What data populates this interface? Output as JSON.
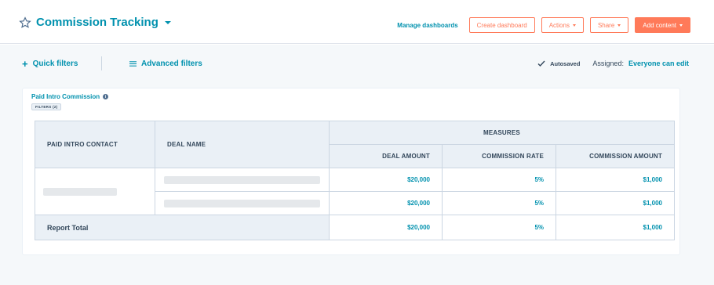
{
  "header": {
    "title": "Commission Tracking",
    "manage_dashboards": "Manage dashboards",
    "create_dashboard": "Create dashboard",
    "actions": "Actions",
    "share": "Share",
    "add_content": "Add content"
  },
  "filters": {
    "quick": "Quick filters",
    "advanced": "Advanced filters",
    "autosaved": "Autosaved",
    "assigned_label": "Assigned:",
    "assigned_value": "Everyone can edit"
  },
  "report": {
    "title": "Paid Intro Commission",
    "filters_badge": "FILTERS (2)",
    "columns": {
      "paid_intro_contact": "PAID INTRO CONTACT",
      "deal_name": "DEAL NAME",
      "measures": "MEASURES",
      "deal_amount": "DEAL AMOUNT",
      "commission_rate": "COMMISSION RATE",
      "commission_amount": "COMMISSION AMOUNT"
    },
    "rows": [
      {
        "deal_amount": "$20,000",
        "commission_rate": "5%",
        "commission_amount": "$1,000"
      },
      {
        "deal_amount": "$20,000",
        "commission_rate": "5%",
        "commission_amount": "$1,000"
      }
    ],
    "total": {
      "label": "Report Total",
      "deal_amount": "$20,000",
      "commission_rate": "5%",
      "commission_amount": "$1,000"
    }
  },
  "colors": {
    "accent": "#0091ae",
    "orange": "#ff7a59",
    "text": "#33475b",
    "border": "#cbd6e2"
  }
}
